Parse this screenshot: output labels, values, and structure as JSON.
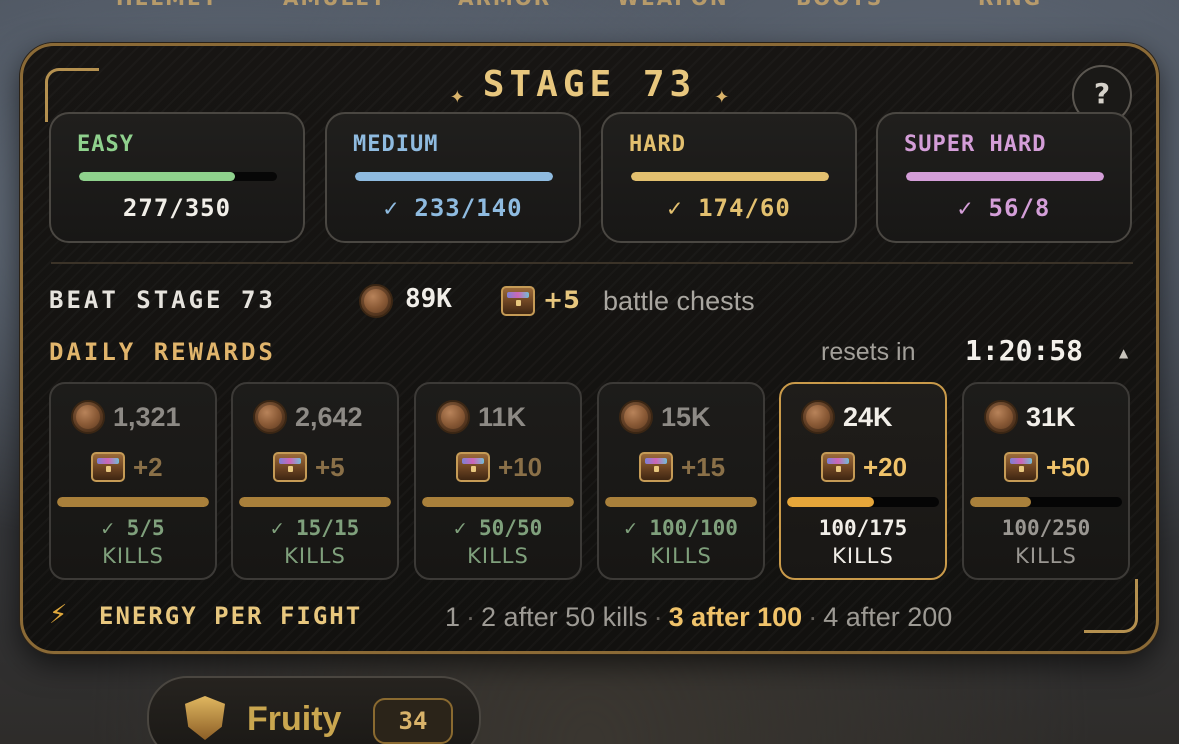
{
  "equipment_tabs": [
    "HELMET",
    "AMULET",
    "ARMOR",
    "WEAPON",
    "BOOTS",
    "RING"
  ],
  "stage": {
    "title": "STAGE 73",
    "help_label": "?"
  },
  "difficulties": [
    {
      "name": "EASY",
      "progress": "277/350",
      "fill": 0.79,
      "color": "#8fd18d"
    },
    {
      "name": "MEDIUM",
      "progress": "✓ 233/140",
      "fill": 1.0,
      "color": "#8fbbe0"
    },
    {
      "name": "HARD",
      "progress": "✓ 174/60",
      "fill": 1.0,
      "color": "#e3c06f"
    },
    {
      "name": "SUPER HARD",
      "progress": "✓ 56/8",
      "fill": 1.0,
      "color": "#d49ed8"
    }
  ],
  "beat": {
    "label": "BEAT STAGE 73",
    "coins": "89K",
    "chests": "+5",
    "chests_text": "battle chests"
  },
  "daily": {
    "title": "DAILY REWARDS",
    "resets_label": "resets in",
    "resets_time": "1:20:58",
    "collapse_icon": "▲",
    "rewards": [
      {
        "coins": "1,321",
        "chests": "+2",
        "progress": "✓ 5/5",
        "kills": "KILLS",
        "fill": 1.0,
        "state": "done"
      },
      {
        "coins": "2,642",
        "chests": "+5",
        "progress": "✓ 15/15",
        "kills": "KILLS",
        "fill": 1.0,
        "state": "done"
      },
      {
        "coins": "11K",
        "chests": "+10",
        "progress": "✓ 50/50",
        "kills": "KILLS",
        "fill": 1.0,
        "state": "done"
      },
      {
        "coins": "15K",
        "chests": "+15",
        "progress": "✓ 100/100",
        "kills": "KILLS",
        "fill": 1.0,
        "state": "done"
      },
      {
        "coins": "24K",
        "chests": "+20",
        "progress": "100/175",
        "kills": "KILLS",
        "fill": 0.571,
        "state": "active"
      },
      {
        "coins": "31K",
        "chests": "+50",
        "progress": "100/250",
        "kills": "KILLS",
        "fill": 0.4,
        "state": "locked"
      }
    ]
  },
  "energy": {
    "icon": "⚡",
    "label": "ENERGY PER FIGHT",
    "step1": "1",
    "step2": "2 after 50 kills",
    "step3": "3 after 100",
    "step4": "4 after 200",
    "separator": "·"
  },
  "player": {
    "name": "Fruity",
    "level": "34"
  },
  "colors": {
    "gold": "#e8c77e",
    "done_green": "#7fa07c",
    "bar_gold": "#a9803b",
    "bar_active": "#e6a63a"
  }
}
